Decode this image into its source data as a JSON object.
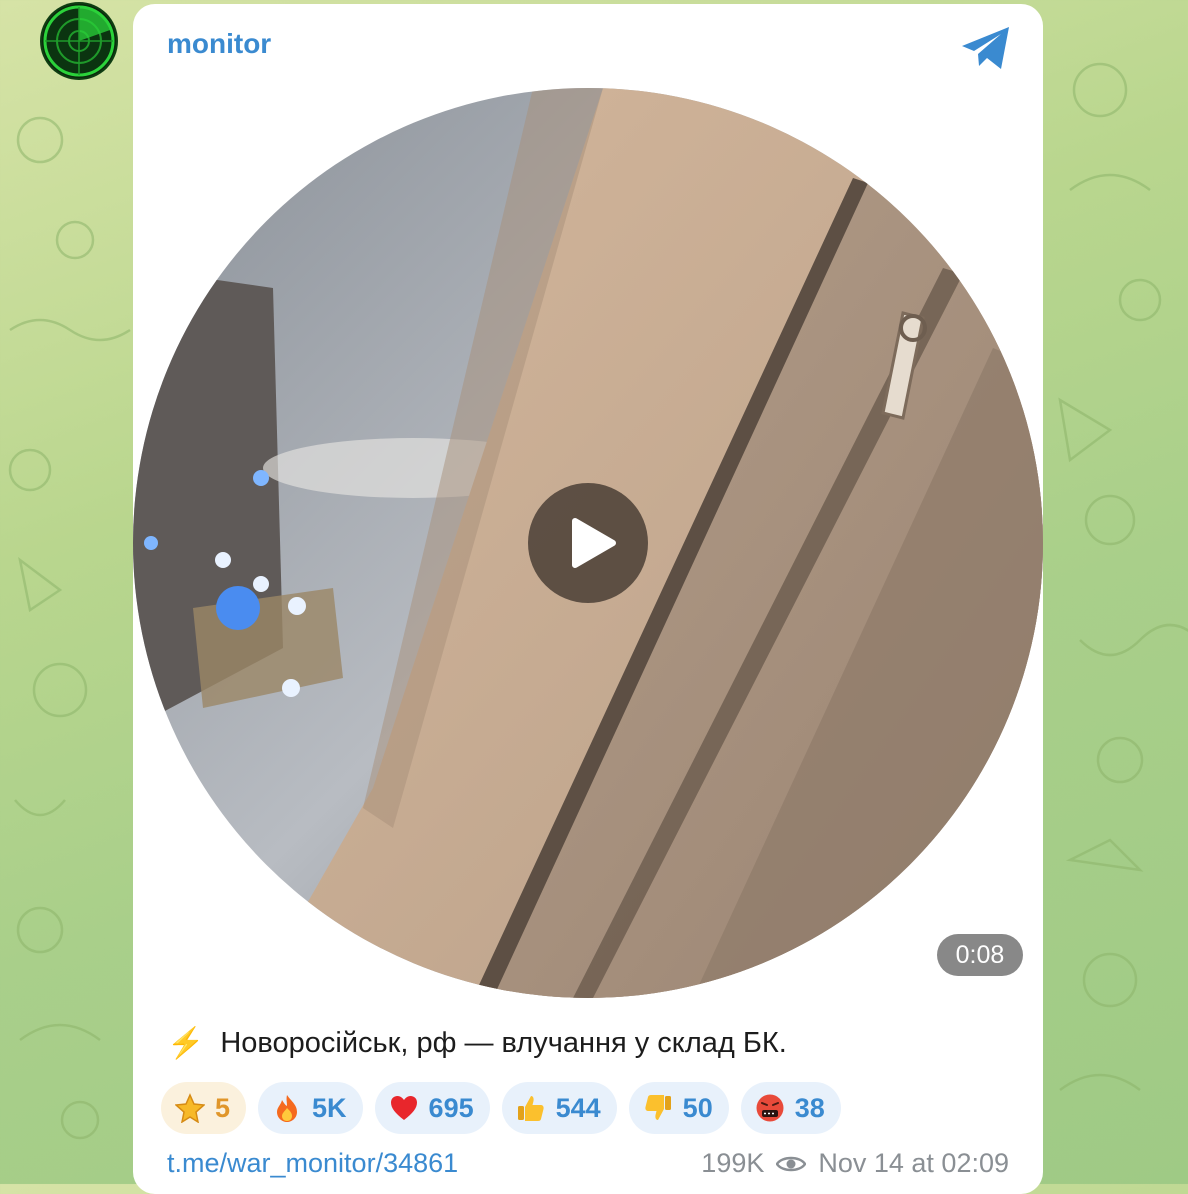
{
  "channel": {
    "name": "monitor"
  },
  "video": {
    "duration": "0:08"
  },
  "post": {
    "caption_icon": "⚡",
    "caption": "Новоросійськ, рф — влучання у склад БК.",
    "link": "t.me/war_monitor/34861",
    "views": "199K",
    "timestamp": "Nov 14 at 02:09"
  },
  "reactions": [
    {
      "icon": "star-icon",
      "count": "5"
    },
    {
      "icon": "fire-icon",
      "count": "5K"
    },
    {
      "icon": "heart-icon",
      "count": "695"
    },
    {
      "icon": "thumbs-up-icon",
      "count": "544"
    },
    {
      "icon": "thumbs-down-icon",
      "count": "50"
    },
    {
      "icon": "cursing-face-icon",
      "count": "38"
    }
  ],
  "colors": {
    "accent": "#3a8ad0",
    "background": "#b9d68e",
    "card": "#ffffff"
  }
}
